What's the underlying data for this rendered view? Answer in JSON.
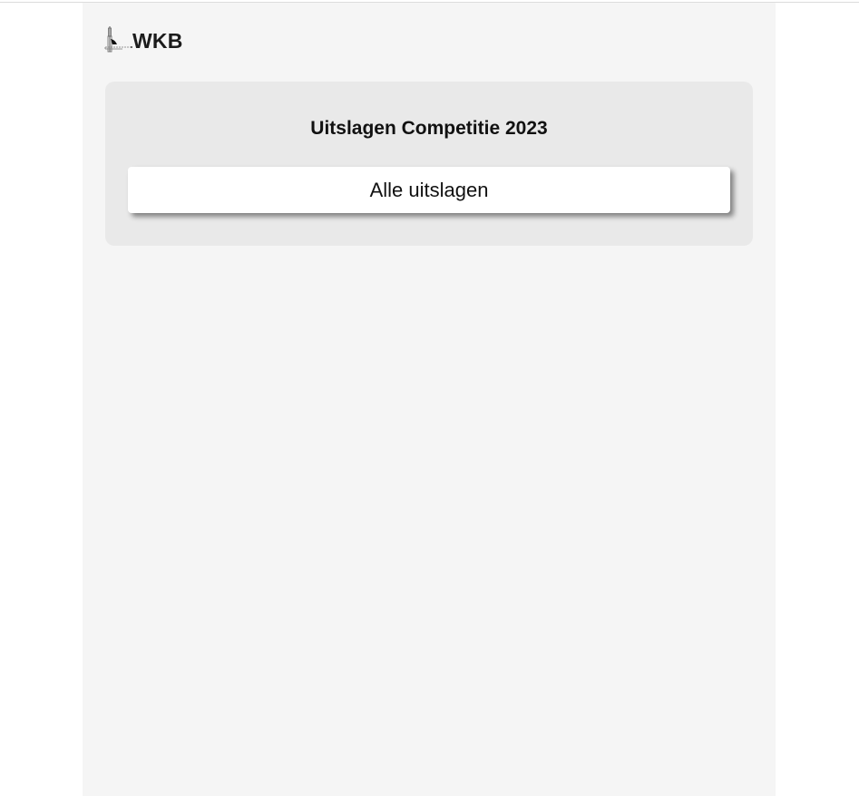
{
  "header": {
    "logo_text": "WKB"
  },
  "main": {
    "card": {
      "title": "Uitslagen Competitie 2023",
      "link_label": "Alle uitslagen"
    }
  },
  "colors": {
    "page_background": "#f5f5f5",
    "card_background": "#e9e9e9",
    "button_background": "#ffffff",
    "text": "#111111"
  }
}
